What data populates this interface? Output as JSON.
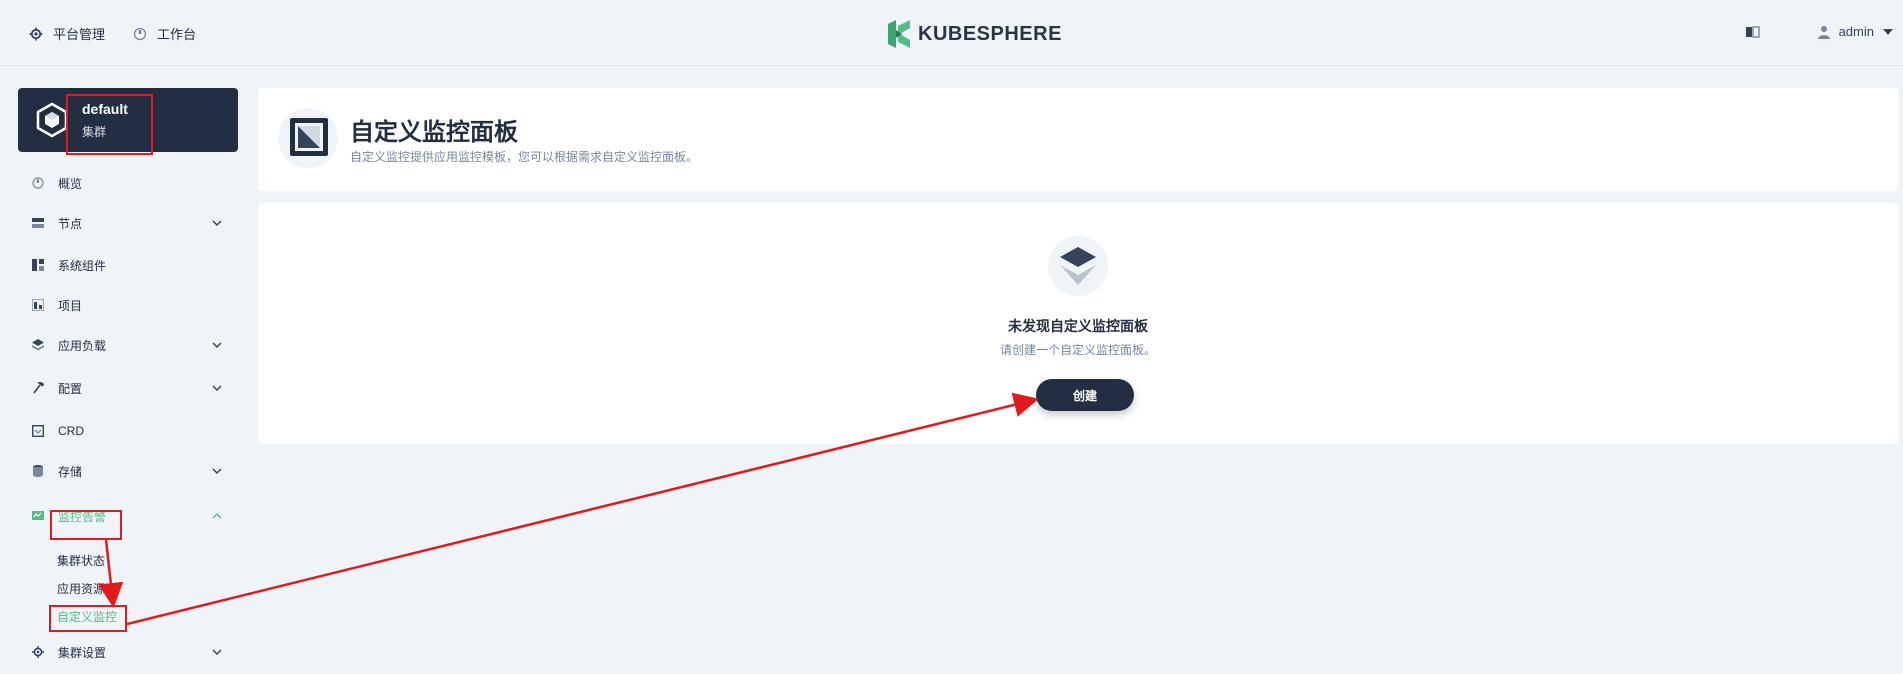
{
  "topbar": {
    "platform_label": "平台管理",
    "workbench_label": "工作台",
    "brand": "KUBESPHERE",
    "user": "admin"
  },
  "cluster": {
    "name": "default",
    "type": "集群"
  },
  "sidebar": {
    "items": [
      {
        "label": "概览"
      },
      {
        "label": "节点"
      },
      {
        "label": "系统组件"
      },
      {
        "label": "项目"
      },
      {
        "label": "应用负载"
      },
      {
        "label": "配置"
      },
      {
        "label": "CRD"
      },
      {
        "label": "存储"
      },
      {
        "label": "监控告警"
      },
      {
        "label": "集群设置"
      }
    ],
    "monitoring_sub": [
      {
        "label": "集群状态"
      },
      {
        "label": "应用资源"
      },
      {
        "label": "自定义监控"
      }
    ]
  },
  "page": {
    "title": "自定义监控面板",
    "description": "自定义监控提供应用监控模板，您可以根据需求自定义监控面板。"
  },
  "empty": {
    "title": "未发现自定义监控面板",
    "description": "请创建一个自定义监控面板。",
    "create_label": "创建"
  },
  "colors": {
    "accent": "#55bc8a",
    "dark": "#242e42",
    "annotation": "#e11b1b"
  }
}
